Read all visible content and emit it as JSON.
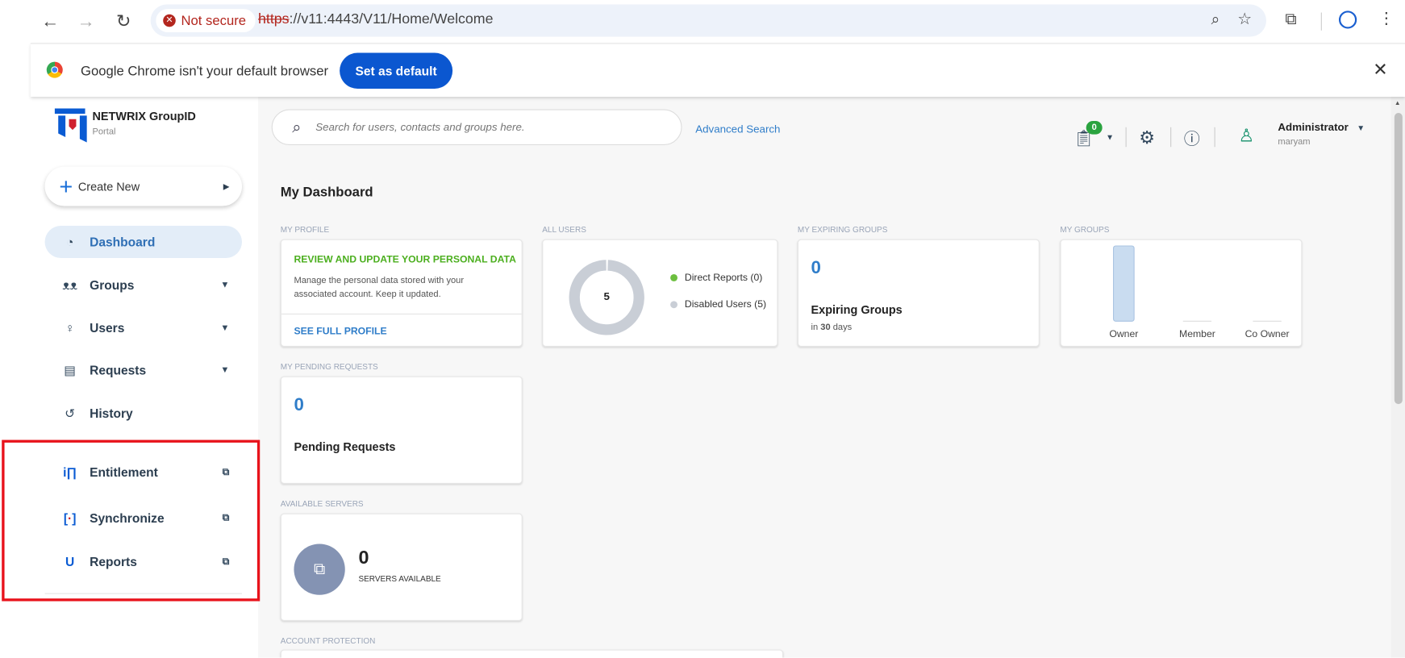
{
  "browser": {
    "not_secure": "Not secure",
    "url_scheme": "https",
    "url_rest": "://v11:4443/V11/Home/Welcome"
  },
  "infobar": {
    "message": "Google Chrome isn't your default browser",
    "button": "Set as default"
  },
  "brand": {
    "name": "NETWRIX GroupID",
    "sub": "Portal"
  },
  "create_new": "Create New",
  "nav": [
    {
      "label": "Dashboard"
    },
    {
      "label": "Groups"
    },
    {
      "label": "Users"
    },
    {
      "label": "Requests"
    },
    {
      "label": "History"
    }
  ],
  "external": [
    {
      "label": "Entitlement"
    },
    {
      "label": "Synchronize"
    },
    {
      "label": "Reports"
    }
  ],
  "search": {
    "placeholder": "Search for users, contacts and groups here.",
    "advanced": "Advanced Search"
  },
  "header": {
    "badge": "0",
    "user": "Administrator",
    "username": "maryam"
  },
  "dashboard": {
    "title": "My Dashboard",
    "profile": {
      "label": "MY PROFILE",
      "heading": "REVIEW AND UPDATE YOUR PERSONAL DATA",
      "text": "Manage the personal data stored with your associated account. Keep it updated.",
      "link": "SEE FULL PROFILE"
    },
    "all_users": {
      "label": "ALL USERS",
      "total": "5",
      "legend": [
        "Direct Reports (0)",
        "Disabled Users (5)"
      ],
      "colors": [
        "#6cbf3f",
        "#c9ced6"
      ]
    },
    "expiring": {
      "label": "MY EXPIRING GROUPS",
      "count": "0",
      "title": "Expiring Groups",
      "in": "in",
      "days": "30",
      "days_label": "days"
    },
    "my_groups": {
      "label": "MY GROUPS",
      "categories": [
        "Owner",
        "Member",
        "Co Owner"
      ],
      "values": [
        1,
        0,
        0
      ]
    },
    "pending": {
      "label": "MY PENDING REQUESTS",
      "count": "0",
      "title": "Pending Requests"
    },
    "servers": {
      "label": "AVAILABLE SERVERS",
      "count": "0",
      "text": "SERVERS AVAILABLE"
    },
    "protection": {
      "label": "ACCOUNT PROTECTION"
    }
  }
}
